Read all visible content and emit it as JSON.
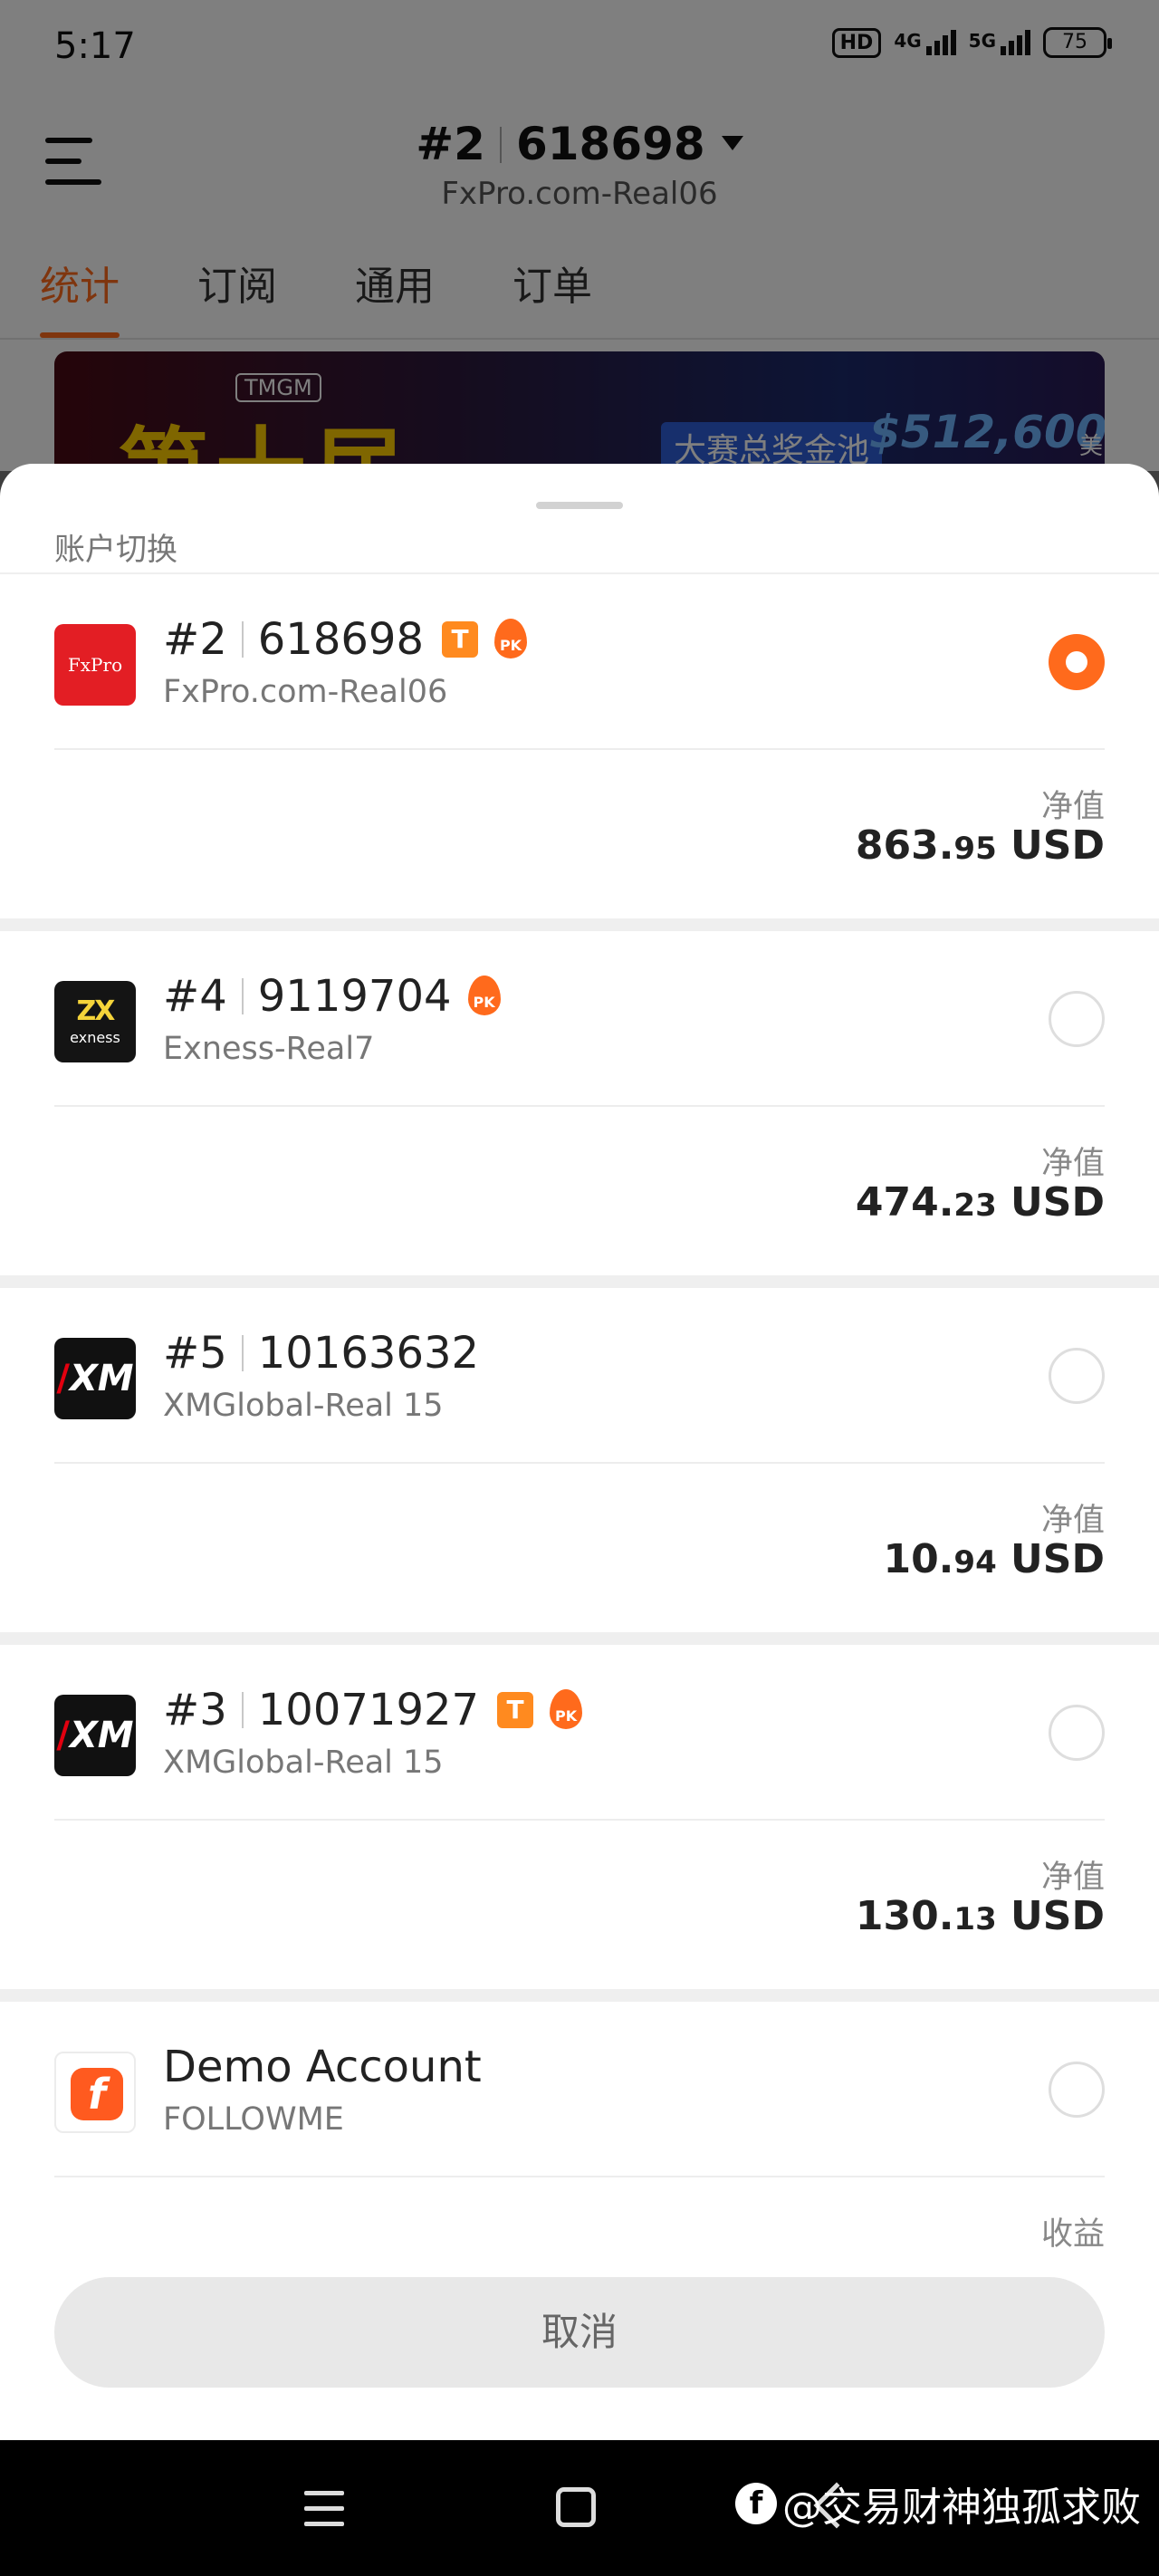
{
  "status_bar": {
    "time": "5:17",
    "hd_label": "HD",
    "net1": "4G",
    "net2": "5G",
    "battery": "75"
  },
  "header": {
    "account_index": "#2",
    "account_number": "618698",
    "server": "FxPro.com-Real06"
  },
  "tabs": [
    {
      "label": "统计",
      "active": true
    },
    {
      "label": "订阅",
      "active": false
    },
    {
      "label": "通用",
      "active": false
    },
    {
      "label": "订单",
      "active": false
    }
  ],
  "banner": {
    "brand": "TMGM",
    "headline": "第十届",
    "pool_label": "大赛总奖金池",
    "amount": "$512,600",
    "unit": "美金"
  },
  "sheet": {
    "title": "账户切换",
    "cancel_label": "取消",
    "accounts": [
      {
        "index": "#2",
        "number": "618698",
        "server": "FxPro.com-Real06",
        "logo_text": "FxPro",
        "badge_t": "T",
        "badge_pk": "PK",
        "selected": true,
        "value_label": "净值",
        "value_int": "863.",
        "value_dec": "95",
        "currency": " USD"
      },
      {
        "index": "#4",
        "number": "9119704",
        "server": "Exness-Real7",
        "logo_mark": "ZX",
        "logo_text": "exness",
        "badge_pk": "PK",
        "selected": false,
        "value_label": "净值",
        "value_int": "474.",
        "value_dec": "23",
        "currency": " USD"
      },
      {
        "index": "#5",
        "number": "10163632",
        "server": "XMGlobal-Real 15",
        "logo_text": "XM",
        "selected": false,
        "value_label": "净值",
        "value_int": "10.",
        "value_dec": "94",
        "currency": " USD"
      },
      {
        "index": "#3",
        "number": "10071927",
        "server": "XMGlobal-Real 15",
        "logo_text": "XM",
        "badge_t": "T",
        "badge_pk": "PK",
        "selected": false,
        "value_label": "净值",
        "value_int": "130.",
        "value_dec": "13",
        "currency": " USD"
      },
      {
        "name": "Demo Account",
        "server": "FOLLOWME",
        "logo_text": "f",
        "selected": false,
        "value_label": "收益"
      }
    ]
  },
  "navbar": {
    "watermark_logo": "f",
    "watermark_text": "@交易财神独孤求败"
  },
  "colors": {
    "accent": "#ff6a1c",
    "badge_t": "#ff8a1f",
    "fxpro_red": "#e31e24"
  }
}
